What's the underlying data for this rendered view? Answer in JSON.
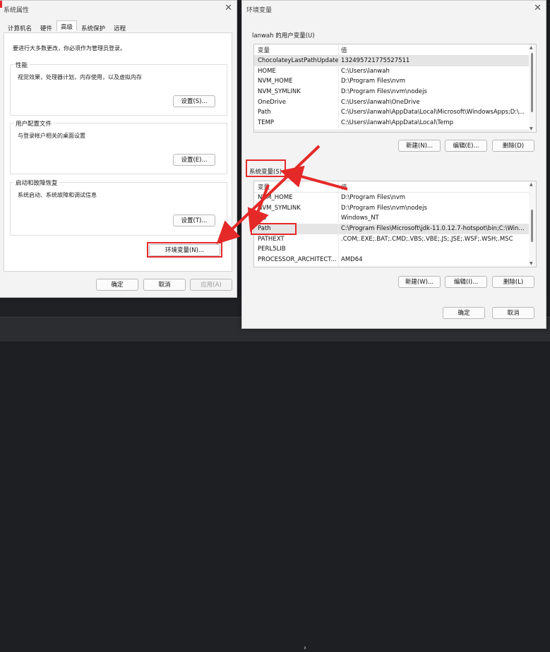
{
  "system_properties": {
    "title": "系统属性",
    "tabs": [
      "计算机名",
      "硬件",
      "高级",
      "系统保护",
      "远程"
    ],
    "active_tab": "高级",
    "notice": "要进行大多数更改，你必须作为管理员登录。",
    "performance": {
      "label": "性能",
      "desc": "视觉效果，处理器计划，内存使用，以及虚拟内存",
      "button": "设置(S)..."
    },
    "user_profile": {
      "label": "用户配置文件",
      "desc": "与登录帐户相关的桌面设置",
      "button": "设置(E)..."
    },
    "startup_recovery": {
      "label": "启动和故障恢复",
      "desc": "系统启动、系统故障和调试信息",
      "button": "设置(T)..."
    },
    "env_button": "环境变量(N)...",
    "ok": "确定",
    "cancel": "取消",
    "apply": "应用(A)"
  },
  "environment_variables": {
    "title": "环境变量",
    "user_section_label": "lanwah 的用户变量(U)",
    "col_variable": "变量",
    "col_value": "值",
    "user_vars": [
      {
        "name": "ChocolateyLastPathUpdate",
        "value": "132495721775527511"
      },
      {
        "name": "HOME",
        "value": "C:\\Users\\lanwah"
      },
      {
        "name": "NVM_HOME",
        "value": "D:\\Program Files\\nvm"
      },
      {
        "name": "NVM_SYMLINK",
        "value": "D:\\Program Files\\nvm\\nodejs"
      },
      {
        "name": "OneDrive",
        "value": "C:\\Users\\lanwah\\OneDrive"
      },
      {
        "name": "Path",
        "value": "C:\\Users\\lanwah\\AppData\\Local\\Microsoft\\WindowsApps;D:\\..."
      },
      {
        "name": "TEMP",
        "value": "C:\\Users\\lanwah\\AppData\\Local\\Temp"
      }
    ],
    "user_buttons": {
      "new": "新建(N)...",
      "edit": "编辑(E)...",
      "delete": "删除(D)"
    },
    "system_section_label": "系统变量(S)",
    "system_vars": [
      {
        "name": "NVM_HOME",
        "value": "D:\\Program Files\\nvm"
      },
      {
        "name": "NVM_SYMLINK",
        "value": "D:\\Program Files\\nvm\\nodejs"
      },
      {
        "name": "OS",
        "value": "Windows_NT"
      },
      {
        "name": "Path",
        "value": "C:\\Program Files\\Microsoft\\jdk-11.0.12.7-hotspot\\bin;C:\\Win..."
      },
      {
        "name": "PATHEXT",
        "value": ".COM;.EXE;.BAT;.CMD;.VBS;.VBE;.JS;.JSE;.WSF;.WSH;.MSC"
      },
      {
        "name": "PERL5LIB",
        "value": ""
      },
      {
        "name": "PROCESSOR_ARCHITECT...",
        "value": "AMD64"
      }
    ],
    "system_buttons": {
      "new": "新建(W)...",
      "edit": "编辑(I)...",
      "delete": "删除(L)"
    },
    "ok": "确定",
    "cancel": "取消"
  },
  "annotation_color": "#e52929"
}
